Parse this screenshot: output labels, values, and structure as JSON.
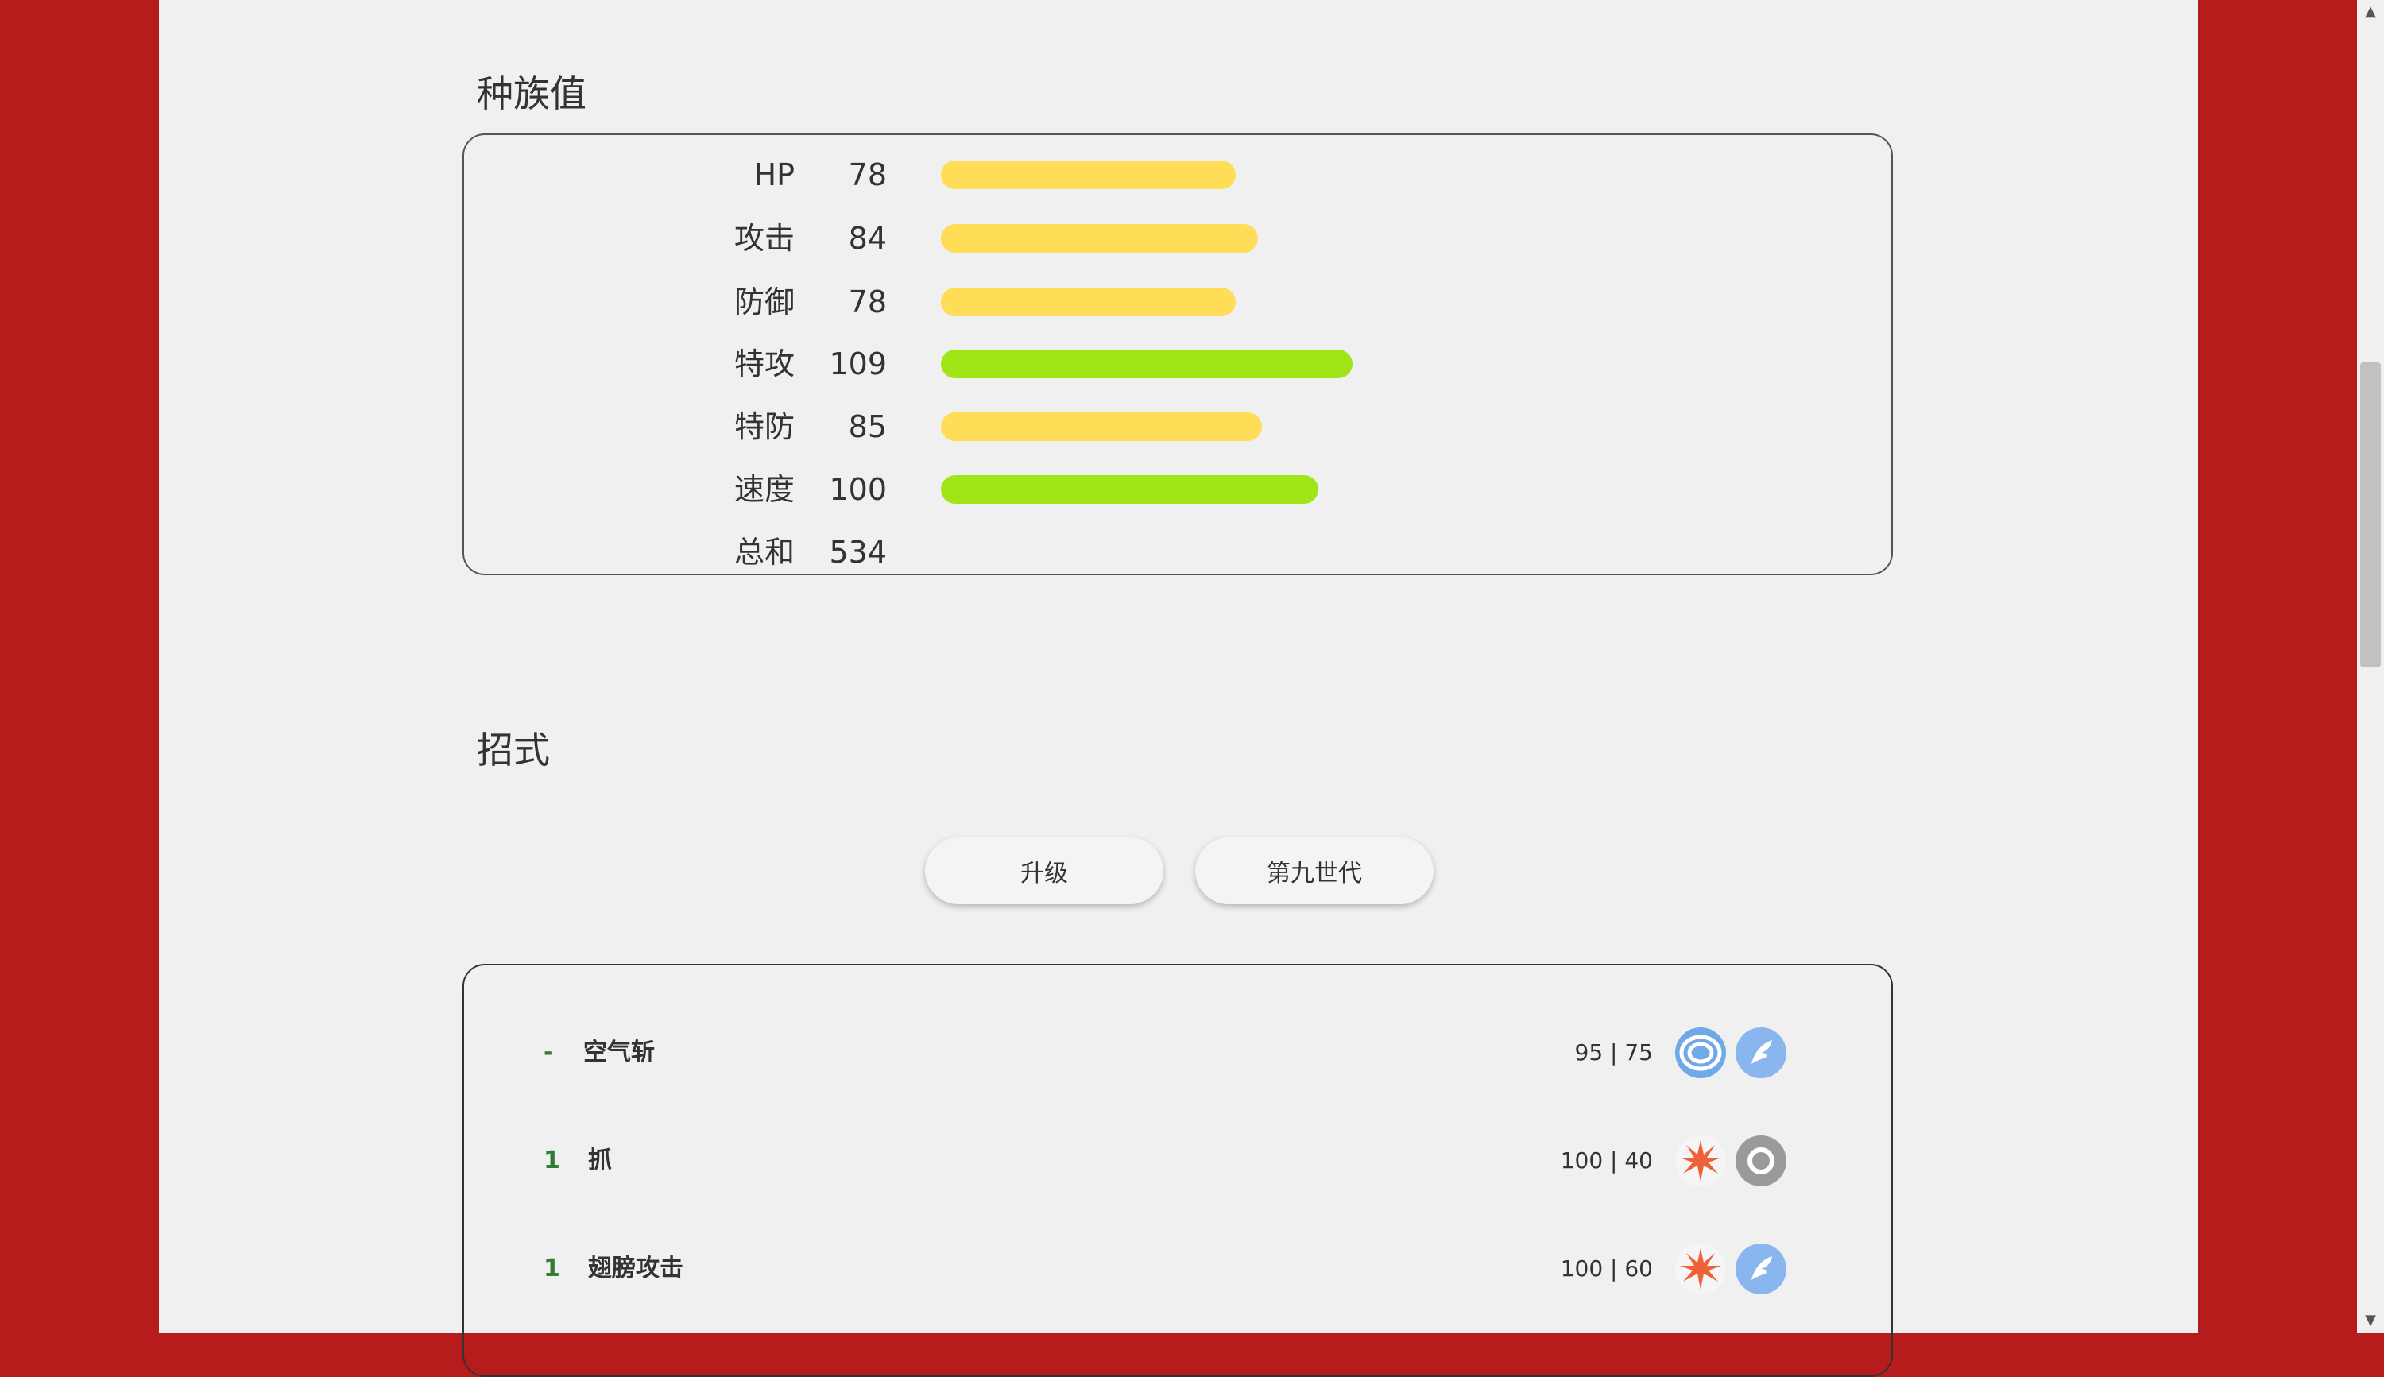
{
  "stats": {
    "title": "种族值",
    "rows": [
      {
        "label": "HP",
        "value": "78",
        "num": 78,
        "color": "#ffdd57"
      },
      {
        "label": "攻击",
        "value": "84",
        "num": 84,
        "color": "#ffdd57"
      },
      {
        "label": "防御",
        "value": "78",
        "num": 78,
        "color": "#ffdd57"
      },
      {
        "label": "特攻",
        "value": "109",
        "num": 109,
        "color": "#a0e515"
      },
      {
        "label": "特防",
        "value": "85",
        "num": 85,
        "color": "#ffdd57"
      },
      {
        "label": "速度",
        "value": "100",
        "num": 100,
        "color": "#a0e515"
      }
    ],
    "total_label": "总和",
    "total_value": "534"
  },
  "moves": {
    "title": "招式",
    "tabs": [
      {
        "label": "升级"
      },
      {
        "label": "第九世代"
      }
    ],
    "rows": [
      {
        "level": "-",
        "name": "空气斩",
        "stats": "95 | 75",
        "category_icon": "special-icon",
        "type_icon": "flying-type-icon"
      },
      {
        "level": "1",
        "name": "抓",
        "stats": "100 | 40",
        "category_icon": "physical-icon",
        "type_icon": "normal-type-icon"
      },
      {
        "level": "1",
        "name": "翅膀攻击",
        "stats": "100 | 60",
        "category_icon": "physical-icon",
        "type_icon": "flying-type-icon"
      }
    ]
  },
  "colors": {
    "background_frame": "#b71c1c",
    "page": "#f0f0f0",
    "bar_low": "#ffdd57",
    "bar_high": "#a0e515",
    "level_text": "#2e7d32",
    "flying": "#89b6ef",
    "special": "#6fa9e8",
    "normal": "#9a9a9a",
    "physical": "#ef6239"
  }
}
